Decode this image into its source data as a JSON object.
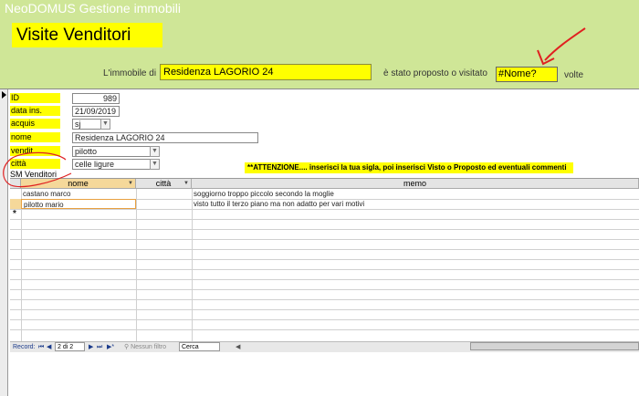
{
  "app_title": "NeoDOMUS Gestione  immobili",
  "form_title": "Visite Venditori",
  "immobile": {
    "prefix": "L'immobile di",
    "value": "Residenza LAGORIO 24",
    "suffix": "è stato proposto o visitato",
    "count_value": "#Nome?",
    "count_suffix": "volte"
  },
  "fields": {
    "id": {
      "label": "ID",
      "value": "989"
    },
    "data_ins": {
      "label": "data ins.",
      "value": "21/09/2019"
    },
    "acquis": {
      "label": "acquis",
      "value": "sj"
    },
    "nome": {
      "label": "nome",
      "value": "Residenza LAGORIO 24"
    },
    "vendit": {
      "label": "vendit",
      "value": "pilotto"
    },
    "citta": {
      "label": "città",
      "value": "celle ligure"
    }
  },
  "subform_label": "SM Venditori",
  "attention": "**ATTENZIONE.... inserisci la tua sigla, poi inserisci Visto o Proposto  ed eventuali commenti",
  "grid": {
    "columns": [
      "nome",
      "città",
      "memo"
    ],
    "rows": [
      {
        "nome": "castano marco",
        "citta": "",
        "memo": "soggiorno troppo piccolo secondo la moglie"
      },
      {
        "nome": "pilotto mario",
        "citta": "",
        "memo": "visto tutto il terzo piano ma non adatto per vari motivi"
      }
    ],
    "new_row_marker": "*"
  },
  "nav": {
    "record_label": "Record:",
    "first": "⏮",
    "prev": "◀",
    "position": "2 di 2",
    "next": "▶",
    "last": "⏭",
    "new": "▶*",
    "filter": "Nessun filtro",
    "search": "Cerca"
  },
  "colors": {
    "header_bg": "#cfe697",
    "highlight": "#ffff00",
    "annotation": "#e02020"
  }
}
